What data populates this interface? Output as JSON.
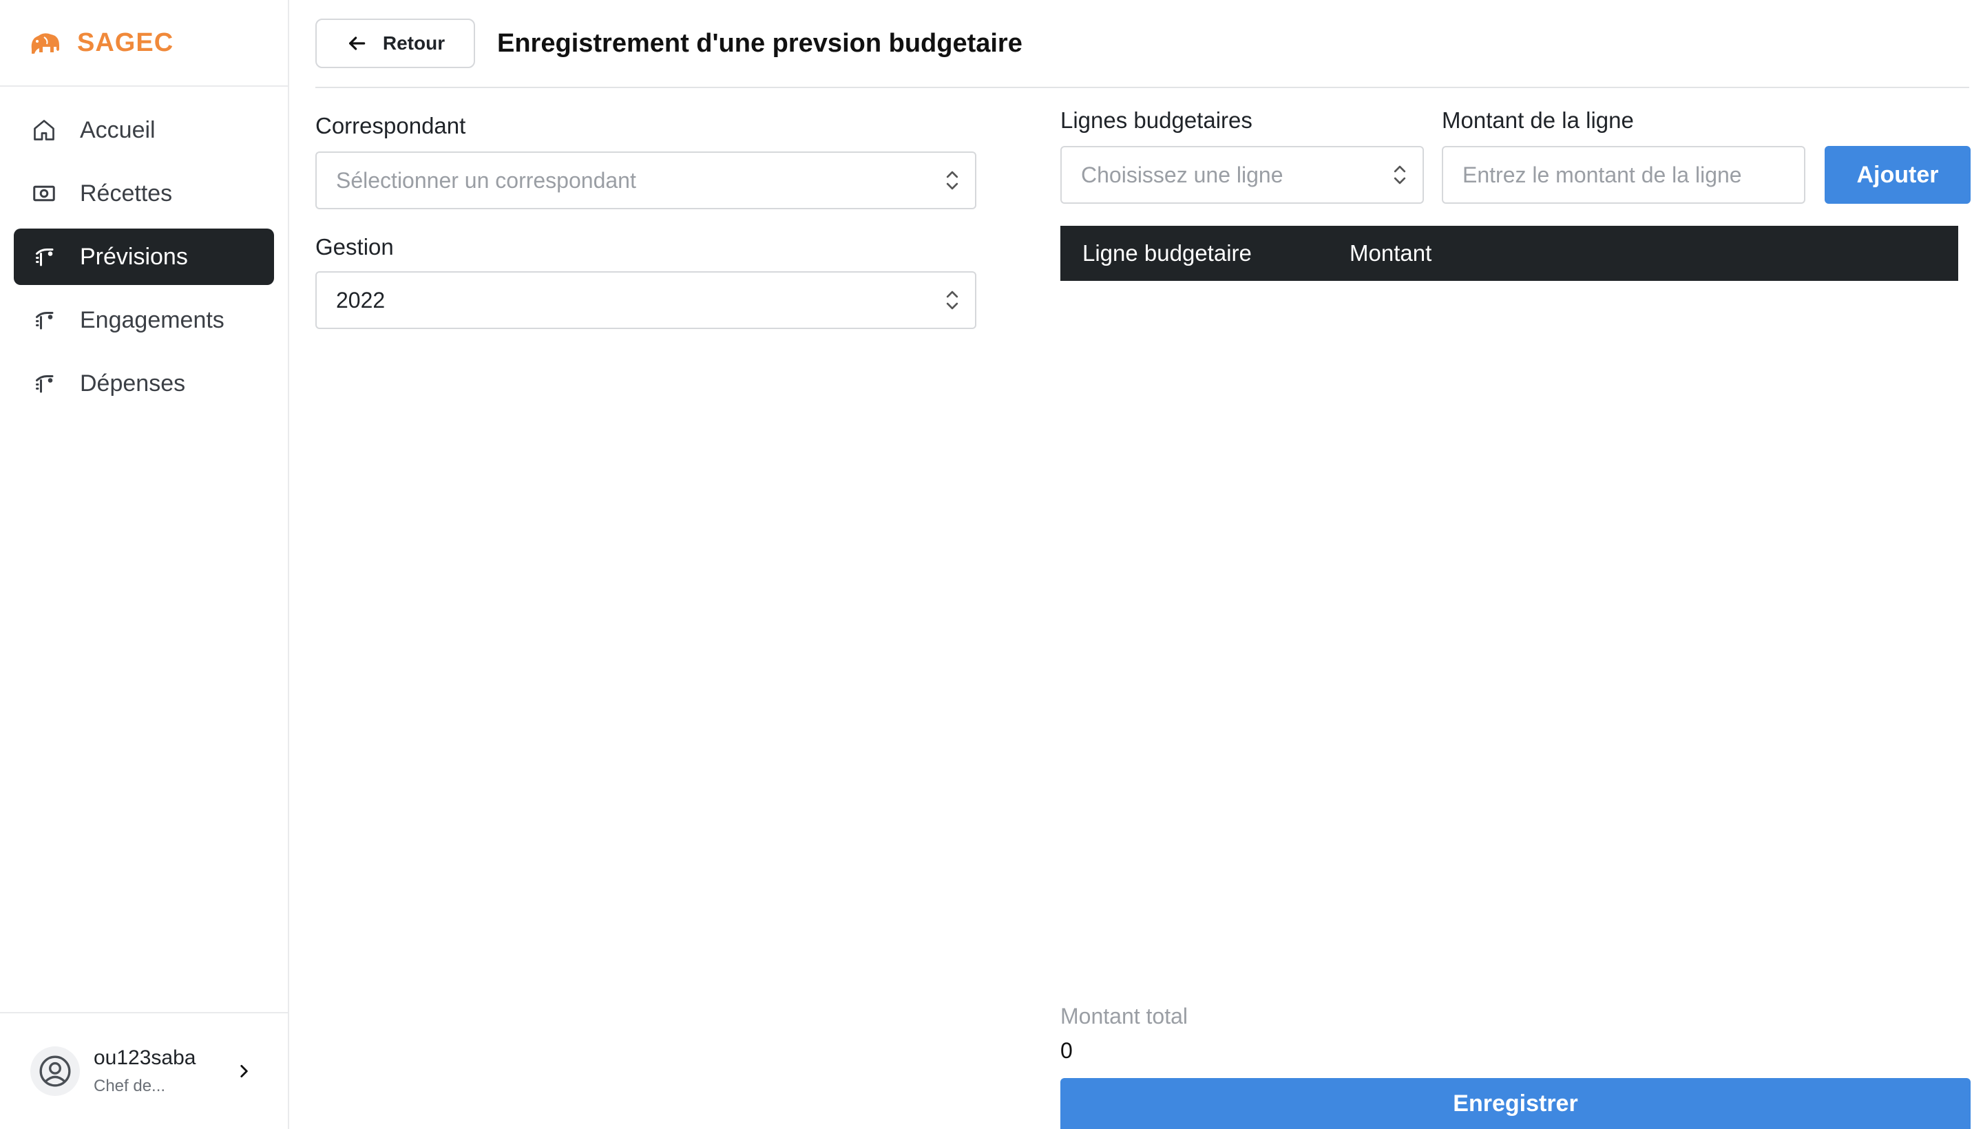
{
  "app": {
    "name": "SAGEC"
  },
  "sidebar": {
    "items": [
      {
        "label": "Accueil",
        "icon": "home-icon",
        "active": false
      },
      {
        "label": "Récettes",
        "icon": "cash-icon",
        "active": false
      },
      {
        "label": "Prévisions",
        "icon": "hand-coins-icon",
        "active": true
      },
      {
        "label": "Engagements",
        "icon": "hand-coins-icon",
        "active": false
      },
      {
        "label": "Dépenses",
        "icon": "hand-coins-icon",
        "active": false
      }
    ]
  },
  "user": {
    "username": "ou123saba",
    "role": "Chef de..."
  },
  "header": {
    "back_label": "Retour",
    "title": "Enregistrement d'une prevsion budgetaire"
  },
  "form": {
    "correspondant": {
      "label": "Correspondant",
      "placeholder": "Sélectionner un correspondant"
    },
    "gestion": {
      "label": "Gestion",
      "value": "2022"
    },
    "lignes": {
      "label": "Lignes budgetaires",
      "placeholder": "Choisissez une ligne"
    },
    "montant": {
      "label": "Montant de la ligne",
      "placeholder": "Entrez le montant de la ligne"
    },
    "add_label": "Ajouter"
  },
  "table": {
    "columns": [
      "Ligne budgetaire",
      "Montant"
    ],
    "rows": []
  },
  "total": {
    "label": "Montant total",
    "value": "0"
  },
  "save_label": "Enregistrer",
  "colors": {
    "brand": "#f0893a",
    "primary": "#3f88e0",
    "dark": "#202427"
  }
}
